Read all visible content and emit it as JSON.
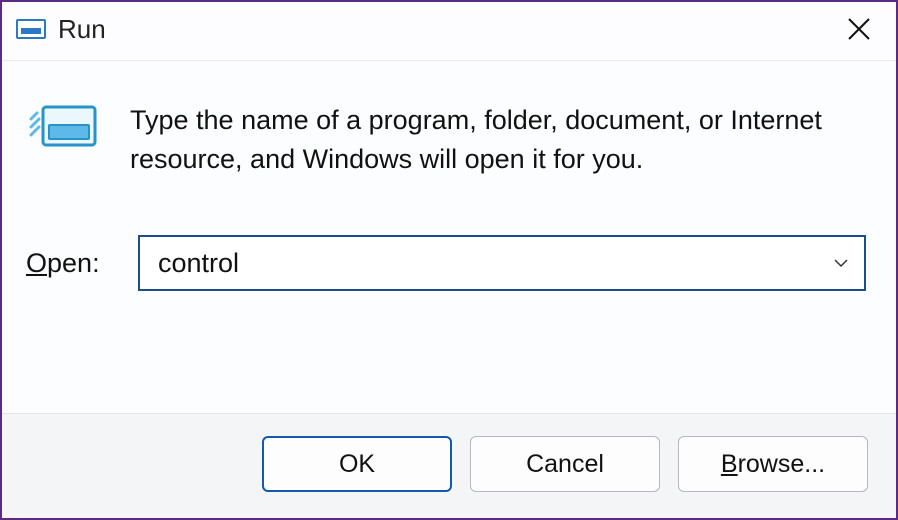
{
  "titlebar": {
    "title": "Run"
  },
  "content": {
    "description": "Type the name of a program, folder, document, or Internet resource, and Windows will open it for you.",
    "open_label_underline": "O",
    "open_label_rest": "pen:",
    "input_value": "control"
  },
  "buttons": {
    "ok": "OK",
    "cancel": "Cancel",
    "browse_underline": "B",
    "browse_rest": "rowse..."
  }
}
